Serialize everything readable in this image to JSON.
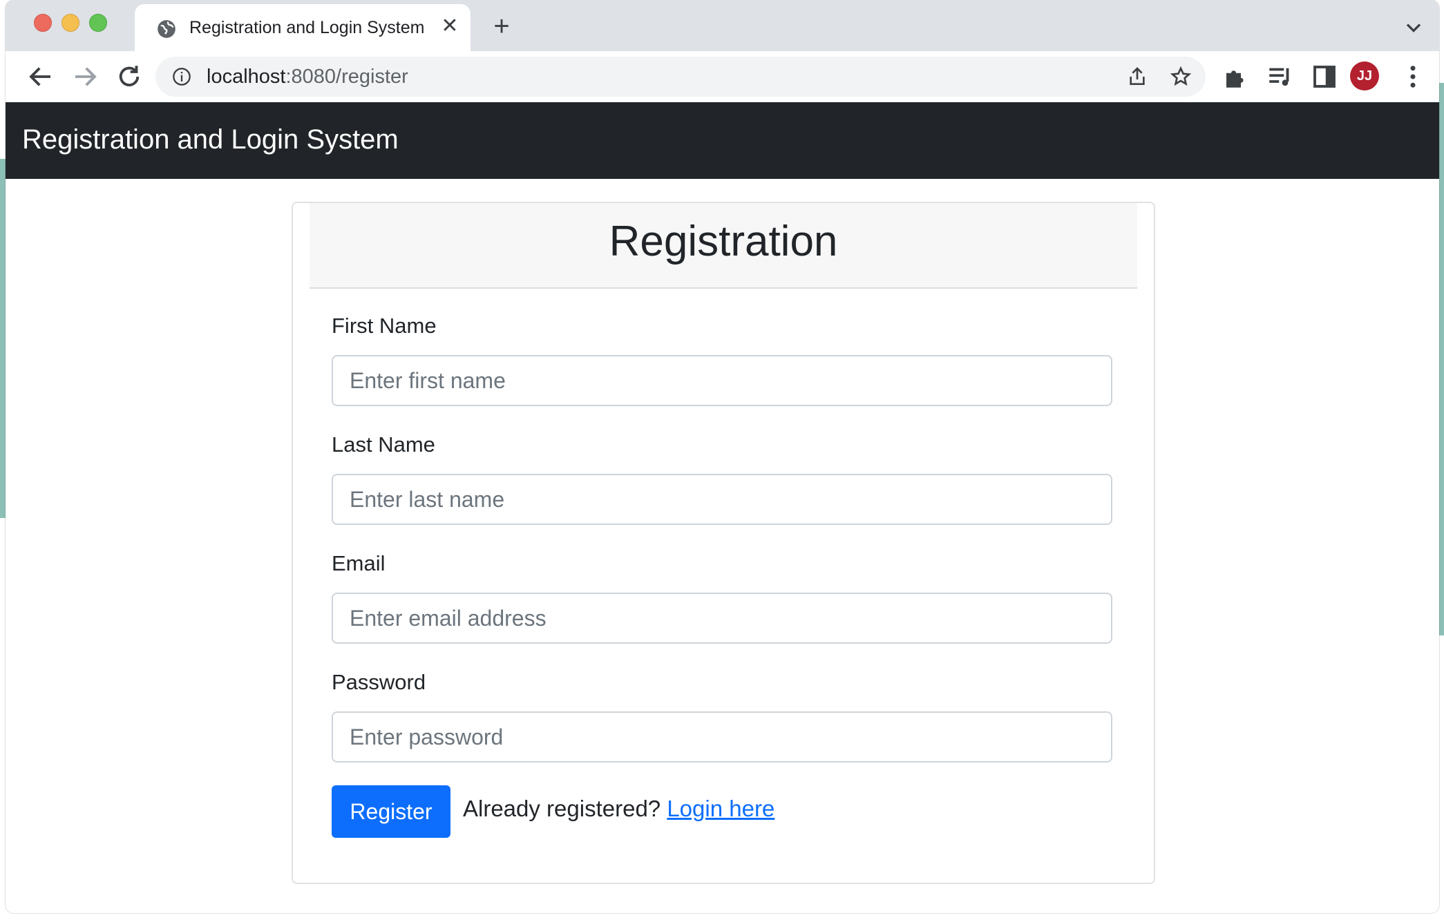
{
  "browser": {
    "tab": {
      "title": "Registration and Login System",
      "close_label": "✕",
      "favicon": "globe-icon"
    },
    "new_tab_label": "+",
    "address_bar": {
      "host": "localhost",
      "path": ":8080/register"
    },
    "profile_initials": "JJ"
  },
  "navbar": {
    "brand": "Registration and Login System"
  },
  "form": {
    "title": "Registration",
    "fields": [
      {
        "label": "First Name",
        "placeholder": "Enter first name"
      },
      {
        "label": "Last Name",
        "placeholder": "Enter last name"
      },
      {
        "label": "Email",
        "placeholder": "Enter email address"
      },
      {
        "label": "Password",
        "placeholder": "Enter password"
      }
    ],
    "submit_label": "Register",
    "login_prompt": "Already registered?",
    "login_link": "Login here"
  },
  "colors": {
    "navbar_bg": "#212529",
    "primary": "#0d6efd"
  }
}
